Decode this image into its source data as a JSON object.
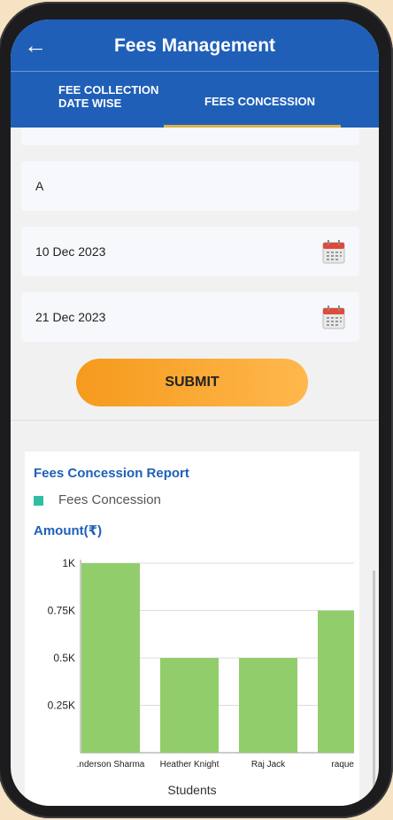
{
  "app": {
    "title": "Fees Management"
  },
  "tabs": [
    {
      "label_line1": "FEE COLLECTION",
      "label_line2": "DATE WISE"
    },
    {
      "label": "FEES CONCESSION",
      "selected": true
    }
  ],
  "form": {
    "name_value": "A",
    "from_date": "10 Dec 2023",
    "to_date": "21 Dec 2023",
    "submit_label": "SUBMIT"
  },
  "report": {
    "title": "Fees Concession Report",
    "legend": "Fees Concession",
    "ylabel": "Amount(₹)",
    "xlabel": "Students"
  },
  "colors": {
    "accent": "#1f5fb8",
    "bar": "#92cd6c",
    "legend": "#2fbfa0",
    "button": "#f7a130"
  },
  "chart_data": {
    "type": "bar",
    "categories": [
      "Anderson Sharma",
      "Heather Knight",
      "Raj Jack",
      "raque"
    ],
    "tick_labels": [
      ".nderson Sharma",
      "Heather Knight",
      "Raj Jack",
      "raque"
    ],
    "series": [
      {
        "name": "Fees Concession",
        "values": [
          1000,
          500,
          500,
          750
        ]
      }
    ],
    "yticks": [
      "1K",
      "0.75K",
      "0.5K",
      "0.25K"
    ],
    "ytick_values": [
      1000,
      750,
      500,
      250
    ],
    "ylim": [
      0,
      1000
    ],
    "ylabel": "Amount(₹)",
    "xlabel": "Students",
    "title": "Fees Concession Report"
  }
}
